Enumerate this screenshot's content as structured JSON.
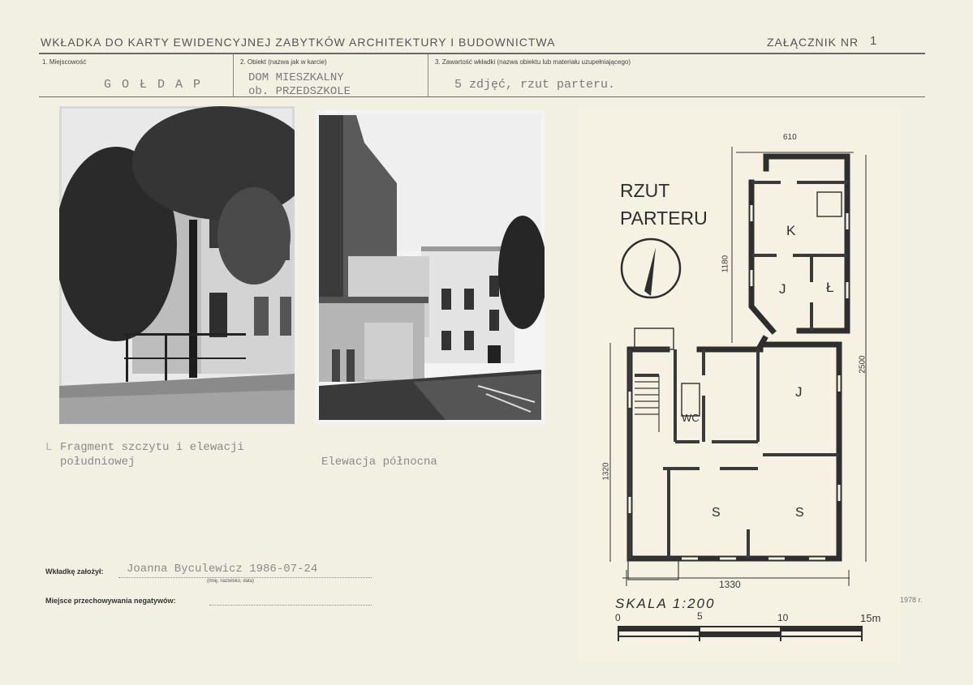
{
  "header": {
    "title": "WKŁADKA DO KARTY EWIDENCYJNEJ ZABYTKÓW ARCHITEKTURY I BUDOWNICTWA",
    "attachment_label": "ZAŁĄCZNIK NR",
    "attachment_number": "1"
  },
  "fields": {
    "f1_label": "1. Miejscowość",
    "f1_value": "G O Ł D A P",
    "f2_label": "2. Obiekt (nazwa jak w karcie)",
    "f2_value_line1": "DOM MIESZKALNY",
    "f2_value_line2": "ob. PRZEDSZKOLE",
    "f3_label": "3. Zawartość wkładki (nazwa obiektu lub materiału uzupełniającego)",
    "f3_value": "5 zdjęć, rzut parteru."
  },
  "captions": {
    "photo1_line1": "Fragment szczytu i elewacji",
    "photo1_line2": "południowej",
    "photo1_mark": "L",
    "photo2": "Elewacja północna"
  },
  "plan": {
    "title_line1": "RZUT",
    "title_line2": "PARTERU",
    "dim_top": "610",
    "dim_left_upper": "1180",
    "dim_right": "2500",
    "dim_left_lower": "1320",
    "dim_bottom": "1330",
    "room_k": "K",
    "room_j1": "J",
    "room_l": "Ł",
    "room_j2": "J",
    "room_wc": "WC",
    "room_s1": "S",
    "room_s2": "S",
    "scale_label": "SKALA  1:200",
    "scale_0": "0",
    "scale_5": "5",
    "scale_10": "10",
    "scale_15": "15m",
    "year_note": "1978 r."
  },
  "footer": {
    "created_label": "Wkładkę założył:",
    "created_value": "Joanna Byculewicz   1986-07-24",
    "created_hint": "(imię, nazwisko, data)",
    "negatives_label": "Miejsce przechowywania negatywów:"
  }
}
